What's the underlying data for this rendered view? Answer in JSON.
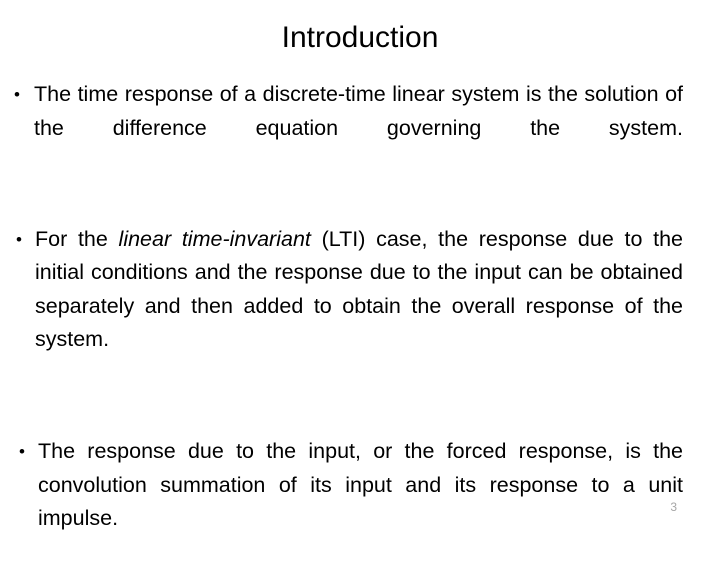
{
  "slide": {
    "title": "Introduction",
    "page_number": "3",
    "bullet_marker": "•",
    "background_color": "#ffffff",
    "text_color": "#000000",
    "page_number_color": "#a6a6a6",
    "bullets": [
      {
        "id": "bullet-1",
        "text": "The time response of a discrete-time linear system is the solution of the difference equation governing the system."
      },
      {
        "id": "bullet-2",
        "text_before_italic": "For the ",
        "italic_text": "linear time-invariant",
        "text_after_italic": " (LTI) case, the response due to the initial conditions and the response due to the input can be obtained separately and then added to obtain the overall response of the system."
      },
      {
        "id": "bullet-3",
        "text": "The response due to the input, or the forced response, is the convolution summation of its input and its response to a unit impulse."
      }
    ]
  }
}
